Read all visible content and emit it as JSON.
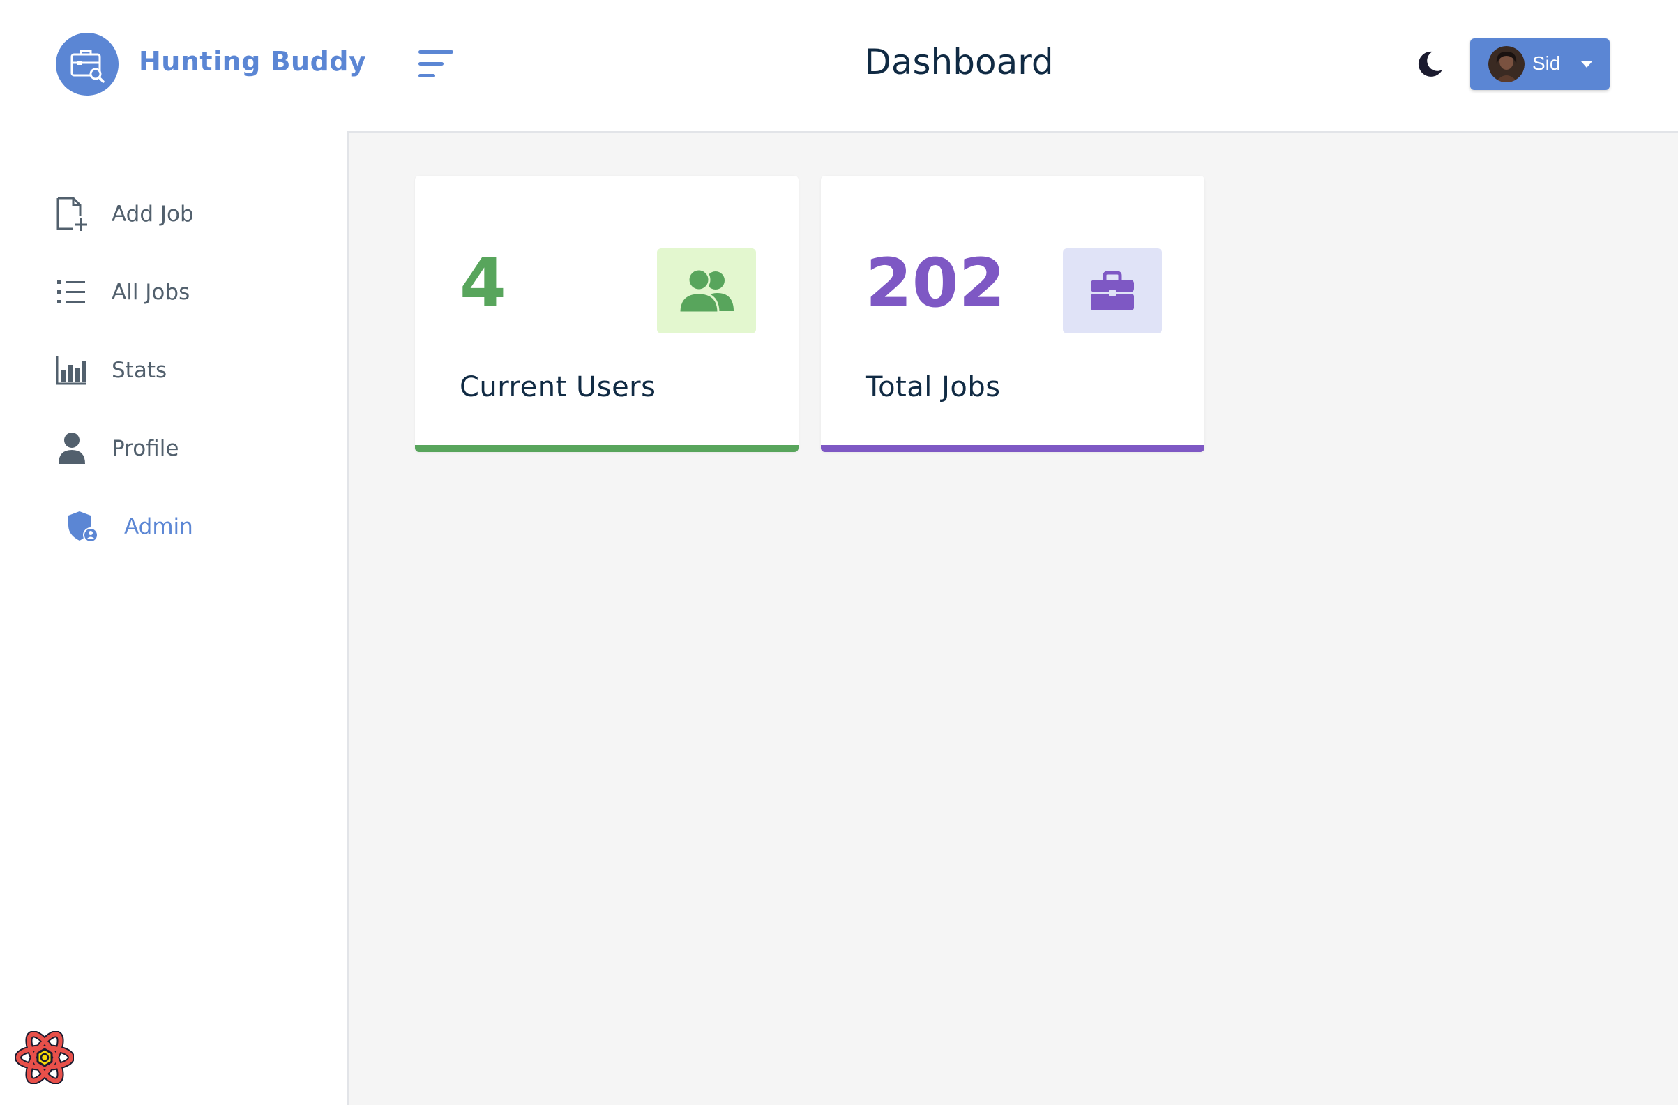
{
  "header": {
    "brand": "Hunting Buddy",
    "page_title": "Dashboard",
    "user_name": "Sid",
    "icons": {
      "logo": "briefcase-search-icon",
      "menu": "menu-toggle-icon",
      "theme": "moon-icon",
      "caret": "caret-down-icon"
    }
  },
  "sidebar": {
    "items": [
      {
        "label": "Add Job",
        "icon": "add-document-icon"
      },
      {
        "label": "All Jobs",
        "icon": "list-icon"
      },
      {
        "label": "Stats",
        "icon": "bar-chart-icon"
      },
      {
        "label": "Profile",
        "icon": "user-icon"
      },
      {
        "label": "Admin",
        "icon": "shield-user-icon",
        "active": true
      }
    ],
    "footer_icon": "react-icon"
  },
  "stats": [
    {
      "count": "4",
      "title": "Current Users",
      "icon": "users-icon",
      "color": "#58a55c",
      "bg": "#e3f7cf"
    },
    {
      "count": "202",
      "title": "Total Jobs",
      "icon": "briefcase-icon",
      "color": "#7e58c4",
      "bg": "#e0e3f7"
    }
  ],
  "colors": {
    "accent": "#5b86d4",
    "nav_text": "#52606d",
    "main_bg": "#f5f5f5"
  }
}
